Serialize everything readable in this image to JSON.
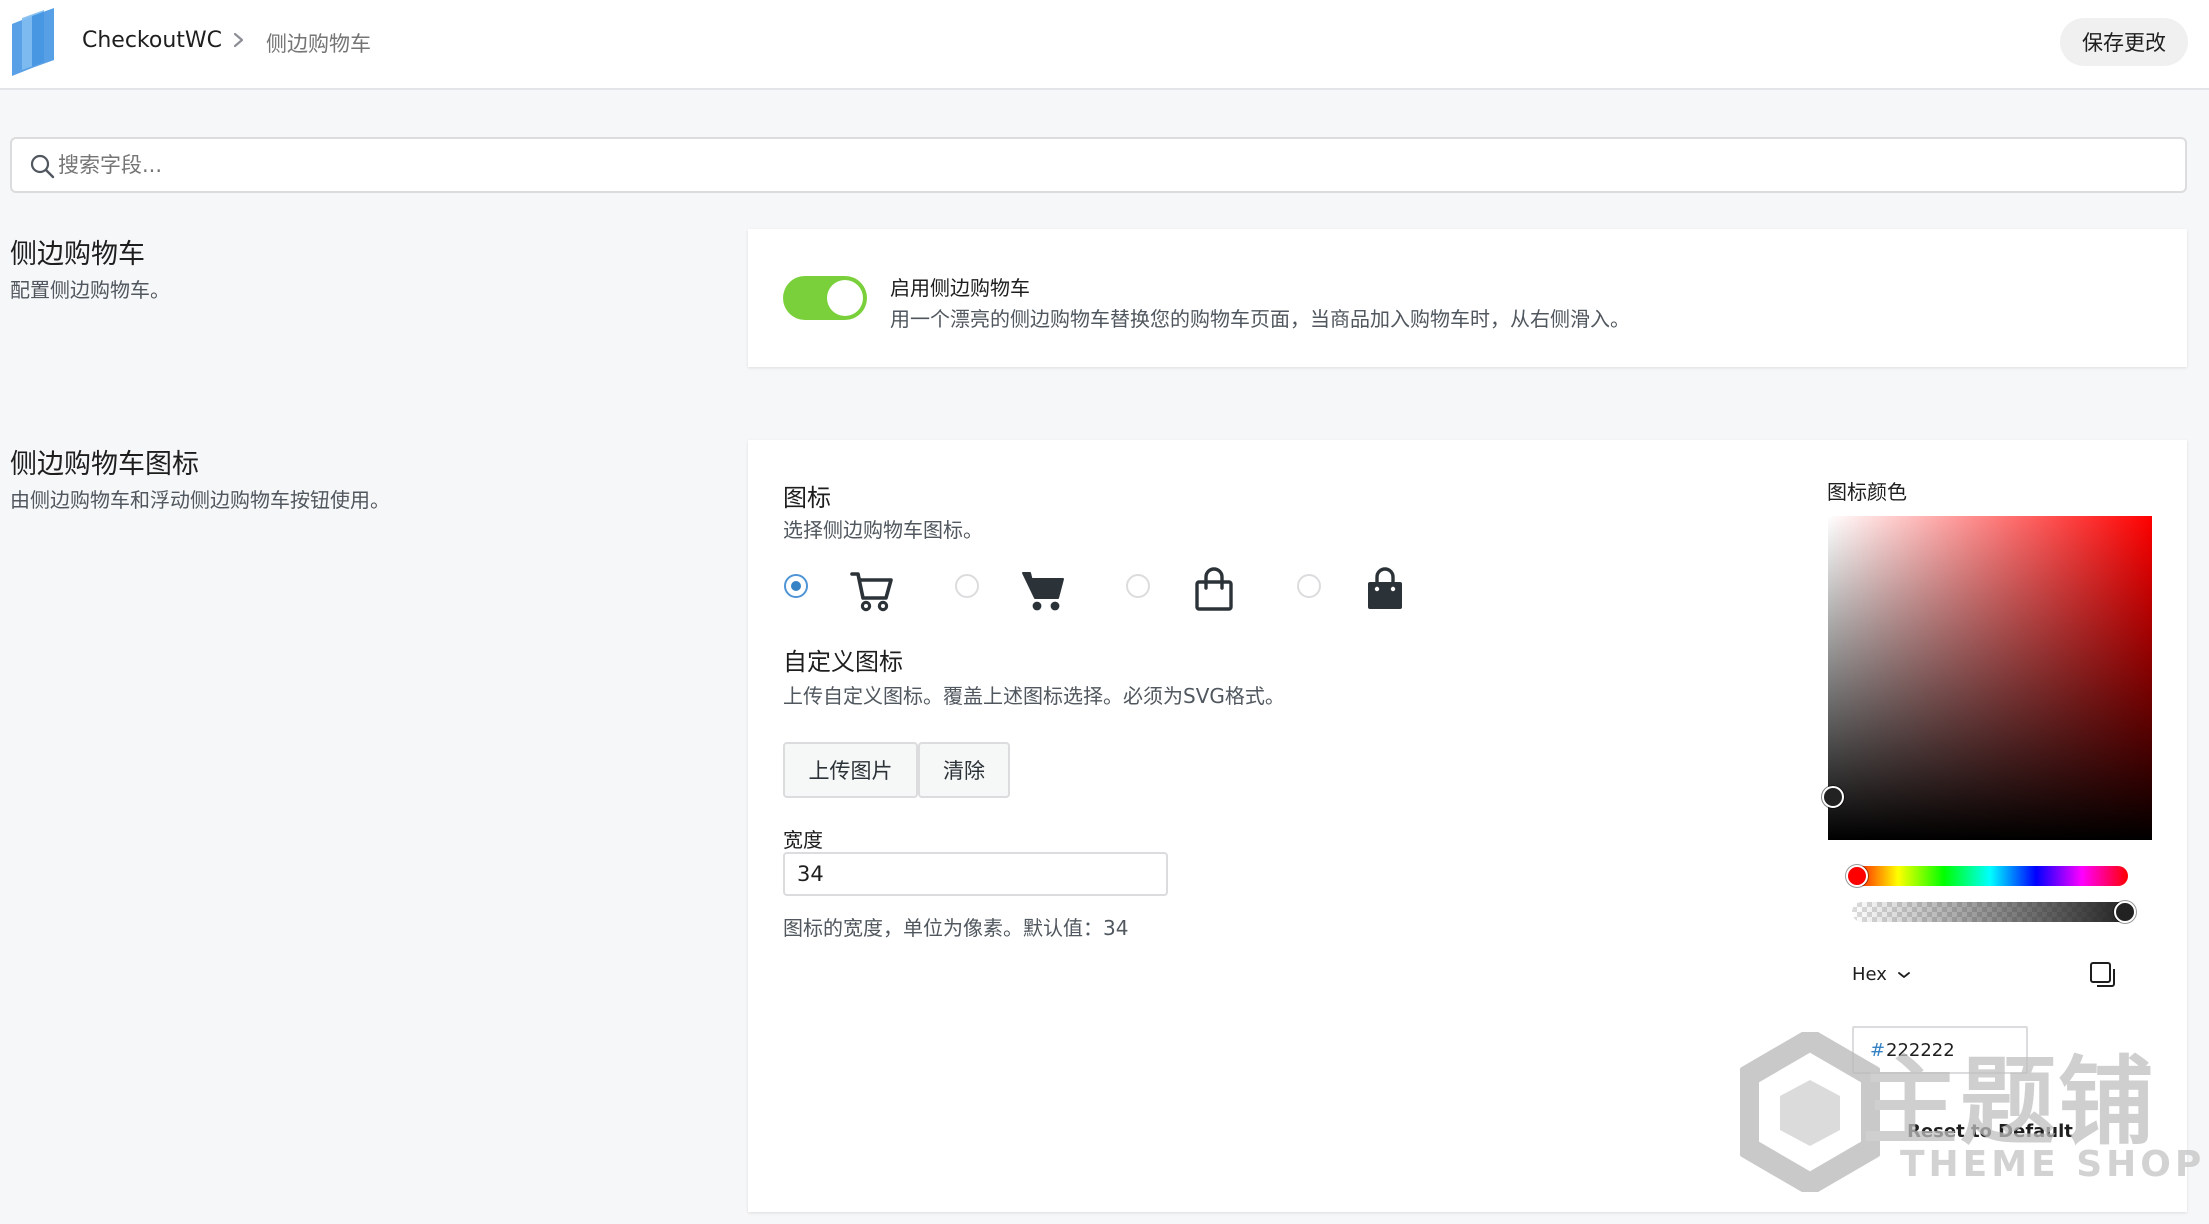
{
  "header": {
    "brand": "CheckoutWC",
    "breadcrumb_current": "侧边购物车",
    "save_label": "保存更改"
  },
  "search": {
    "placeholder": "搜索字段..."
  },
  "side_cart_section": {
    "title": "侧边购物车",
    "description": "配置侧边购物车。",
    "toggle": {
      "enabled": true,
      "title": "启用侧边购物车",
      "description": "用一个漂亮的侧边购物车替换您的购物车页面，当商品加入购物车时，从右侧滑入。"
    }
  },
  "icon_section": {
    "title": "侧边购物车图标",
    "description": "由侧边购物车和浮动侧边购物车按钮使用。",
    "icon_field": {
      "label": "图标",
      "help": "选择侧边购物车图标。",
      "options": [
        {
          "icon": "cart-outline-icon",
          "selected": true
        },
        {
          "icon": "cart-solid-icon",
          "selected": false
        },
        {
          "icon": "bag-outline-icon",
          "selected": false
        },
        {
          "icon": "bag-solid-icon",
          "selected": false
        }
      ]
    },
    "custom_icon": {
      "label": "自定义图标",
      "help": "上传自定义图标。覆盖上述图标选择。必须为SVG格式。",
      "upload_label": "上传图片",
      "clear_label": "清除"
    },
    "width": {
      "label": "宽度",
      "value": "34",
      "help": "图标的宽度，单位为像素。默认值：34"
    },
    "color": {
      "label": "图标颜色",
      "format": "Hex",
      "hex_prefix": "#",
      "value": "222222",
      "reset_label": "Reset to Default"
    }
  },
  "watermark": {
    "cn": "主题铺",
    "en": "THEME SHOP"
  },
  "colors": {
    "accent": "#3582c4",
    "toggle_on": "#7ad03a",
    "icon": "#222222",
    "picker_hue": "#ff0000"
  }
}
